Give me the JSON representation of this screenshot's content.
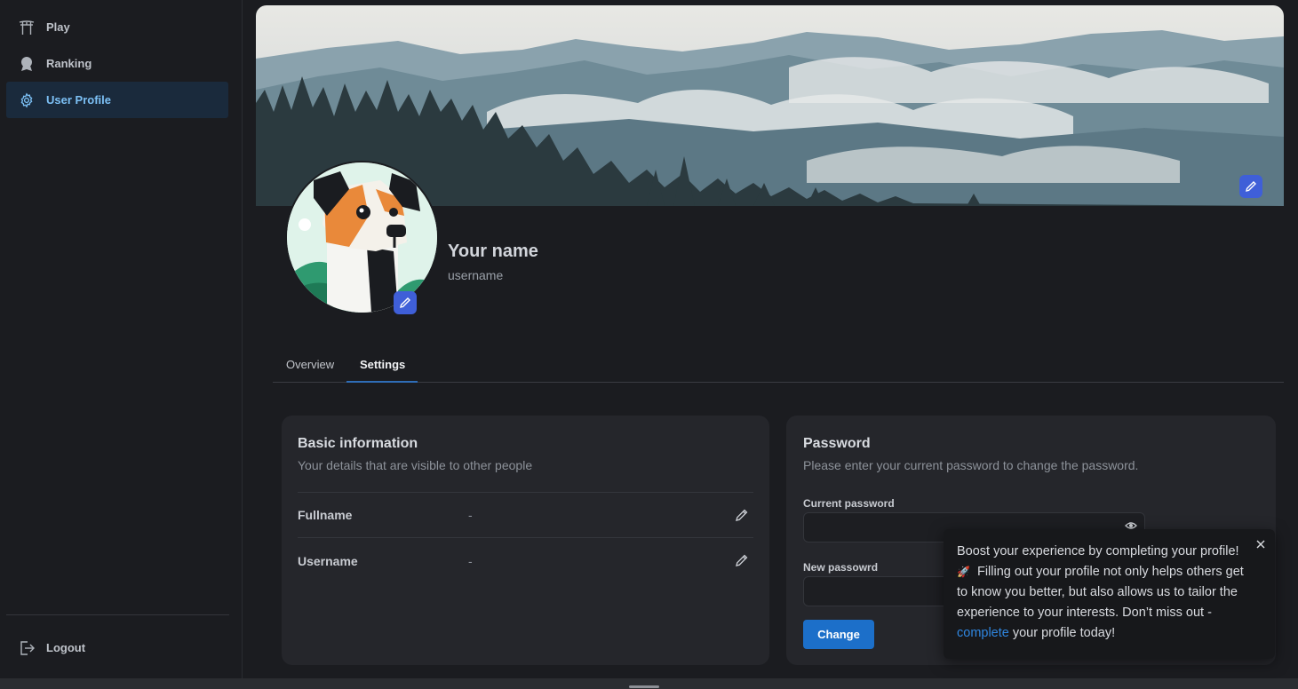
{
  "sidebar": {
    "items": [
      {
        "label": "Play",
        "icon": "torii-gate-icon"
      },
      {
        "label": "Ranking",
        "icon": "award-icon"
      },
      {
        "label": "User Profile",
        "icon": "gear-icon",
        "active": true
      }
    ],
    "logout": {
      "label": "Logout",
      "icon": "logout-icon"
    }
  },
  "profile": {
    "name": "Your name",
    "username": "username"
  },
  "tabs": [
    {
      "label": "Overview"
    },
    {
      "label": "Settings",
      "active": true
    }
  ],
  "basic_info": {
    "title": "Basic information",
    "subtitle": "Your details that are visible to other people",
    "fields": [
      {
        "label": "Fullname",
        "value": "-"
      },
      {
        "label": "Username",
        "value": "-"
      }
    ]
  },
  "password": {
    "title": "Password",
    "subtitle": "Please enter your current password to change the password.",
    "current_label": "Current password",
    "new_label": "New passowrd",
    "change_label": "Change"
  },
  "toast": {
    "text_1": "Boost your experience by completing your profile!",
    "rocket": "🚀",
    "text_2": " Filling out your profile not only helps others get to know you better, but also allows us to tailor the experience to your interests. Don’t miss out - ",
    "link": "complete",
    "text_3": " your profile today!"
  },
  "colors": {
    "accent": "#1c6fc9",
    "active_nav_bg": "#1a2a3c",
    "active_nav_text": "#7cc0f5",
    "edit_button": "#3f5fd8"
  }
}
